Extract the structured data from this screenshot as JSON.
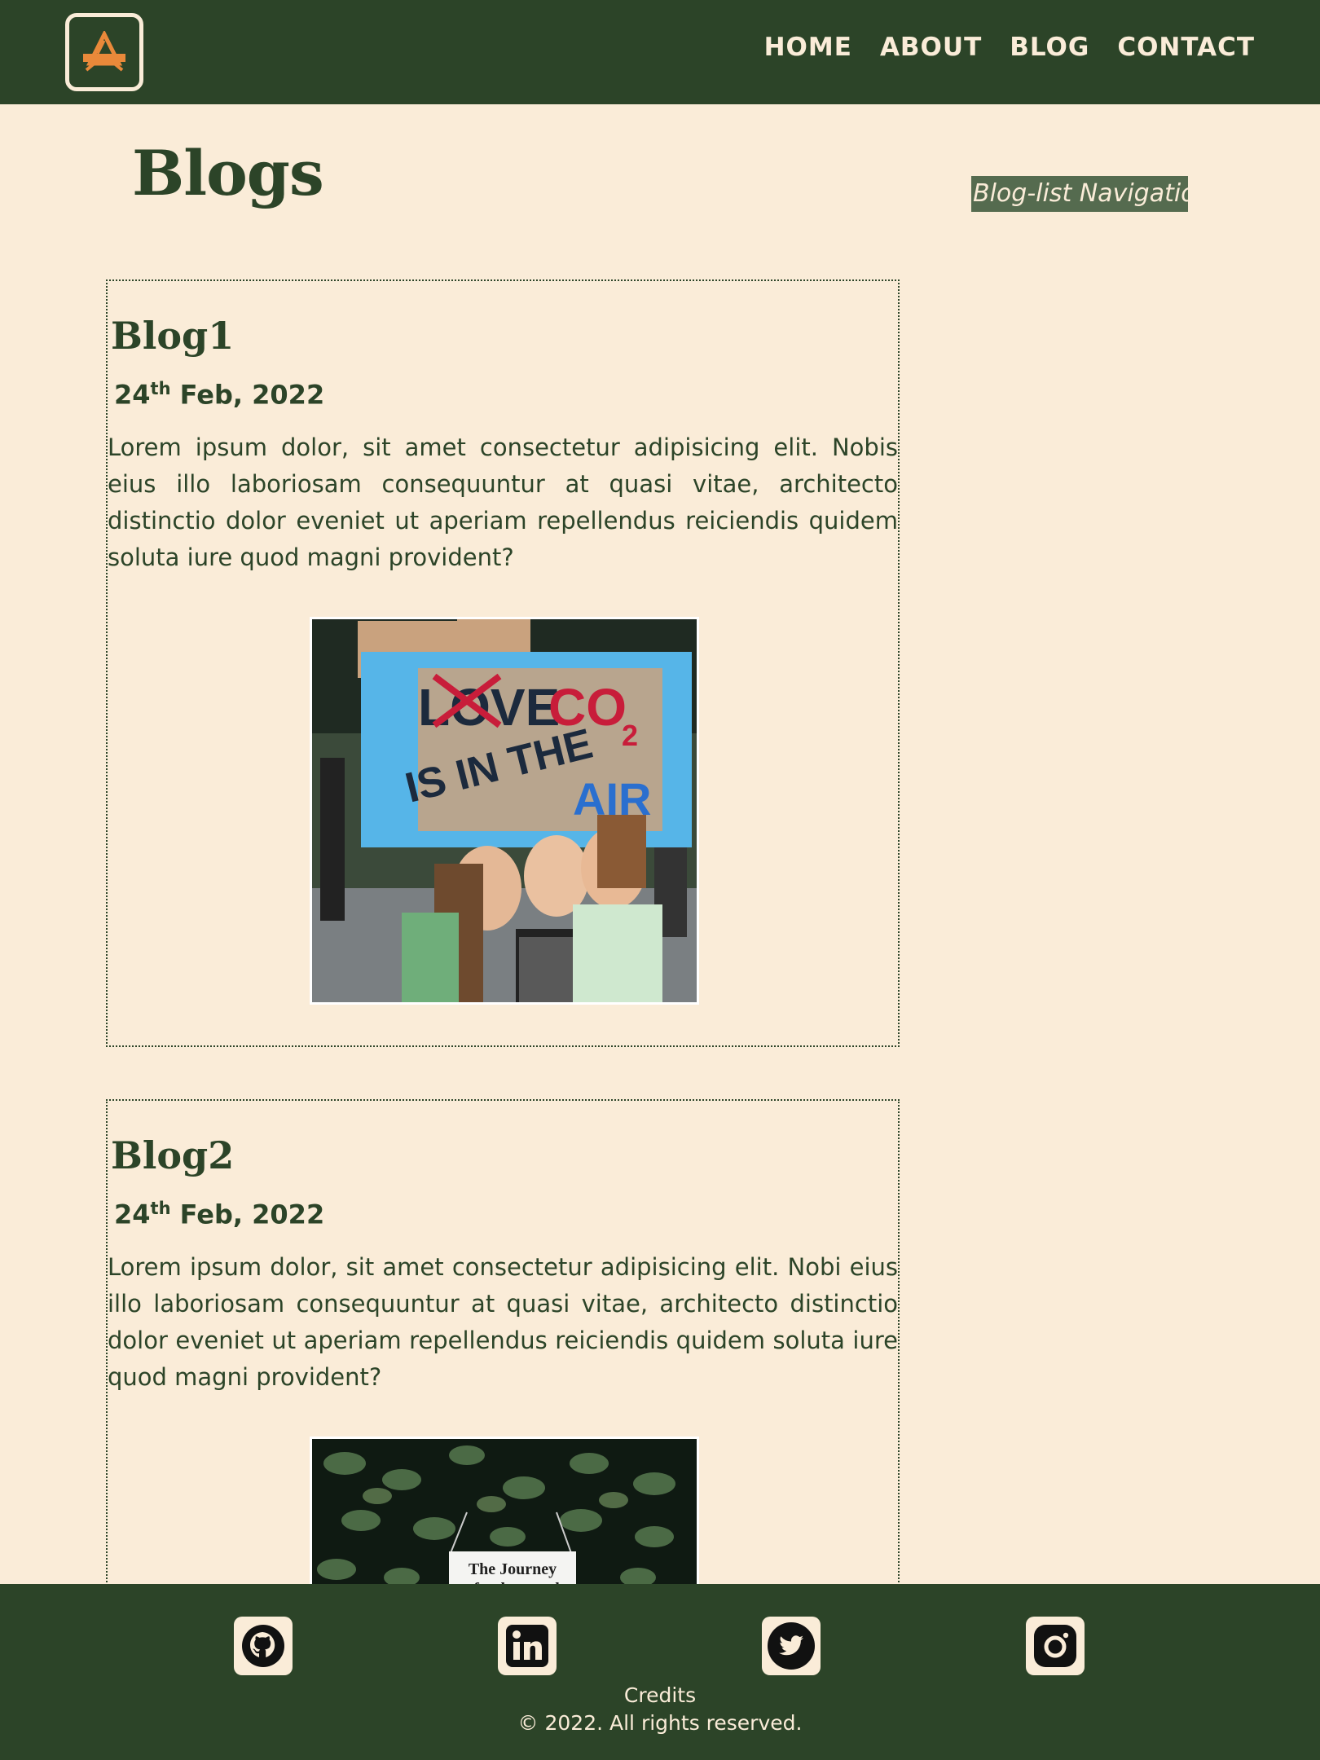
{
  "header": {
    "logo_icon": "construction-logo-icon",
    "nav": [
      "HOME",
      "ABOUT",
      "BLOG",
      "CONTACT"
    ]
  },
  "page": {
    "title": "Blogs",
    "side_nav_label": "Blog-list Navigation"
  },
  "blogs": [
    {
      "title": "Blog1",
      "date_day": "24",
      "date_suffix": "th",
      "date_rest": "Feb, 2022",
      "text": "Lorem ipsum dolor, sit amet consectetur adipisicing elit. Nobis eius illo laboriosam consequuntur at quasi vitae, architecto distinctio dolor eveniet ut aperiam repellendus reiciendis quidem soluta iure quod magni provident?",
      "image": {
        "sign_line1": "LOVE",
        "sign_co": "CO",
        "sign_sub": "2",
        "sign_line2": "IS IN THE",
        "sign_air": "AIR"
      }
    },
    {
      "title": "Blog2",
      "date_day": "24",
      "date_suffix": "th",
      "date_rest": "Feb, 2022",
      "text": "Lorem ipsum dolor, sit amet consectetur adipisicing elit. Nobi eius illo laboriosam consequuntur at quasi vitae, architecto distinctio dolor eveniet ut aperiam repellendus reiciendis quidem soluta iure quod magni provident?",
      "image": {
        "sign_line1": "The Journey",
        "sign_line2": "of a thousand"
      }
    }
  ],
  "footer": {
    "social_icons": [
      "github-icon",
      "linkedin-icon",
      "twitter-icon",
      "instagram-icon"
    ],
    "credits": "Credits",
    "copyright": "© 2022. All rights reserved."
  },
  "colors": {
    "primary_green": "#2c4428",
    "cream_bg": "#faecd8",
    "side_nav_bg": "#556b4f",
    "logo_orange": "#e9893a"
  }
}
